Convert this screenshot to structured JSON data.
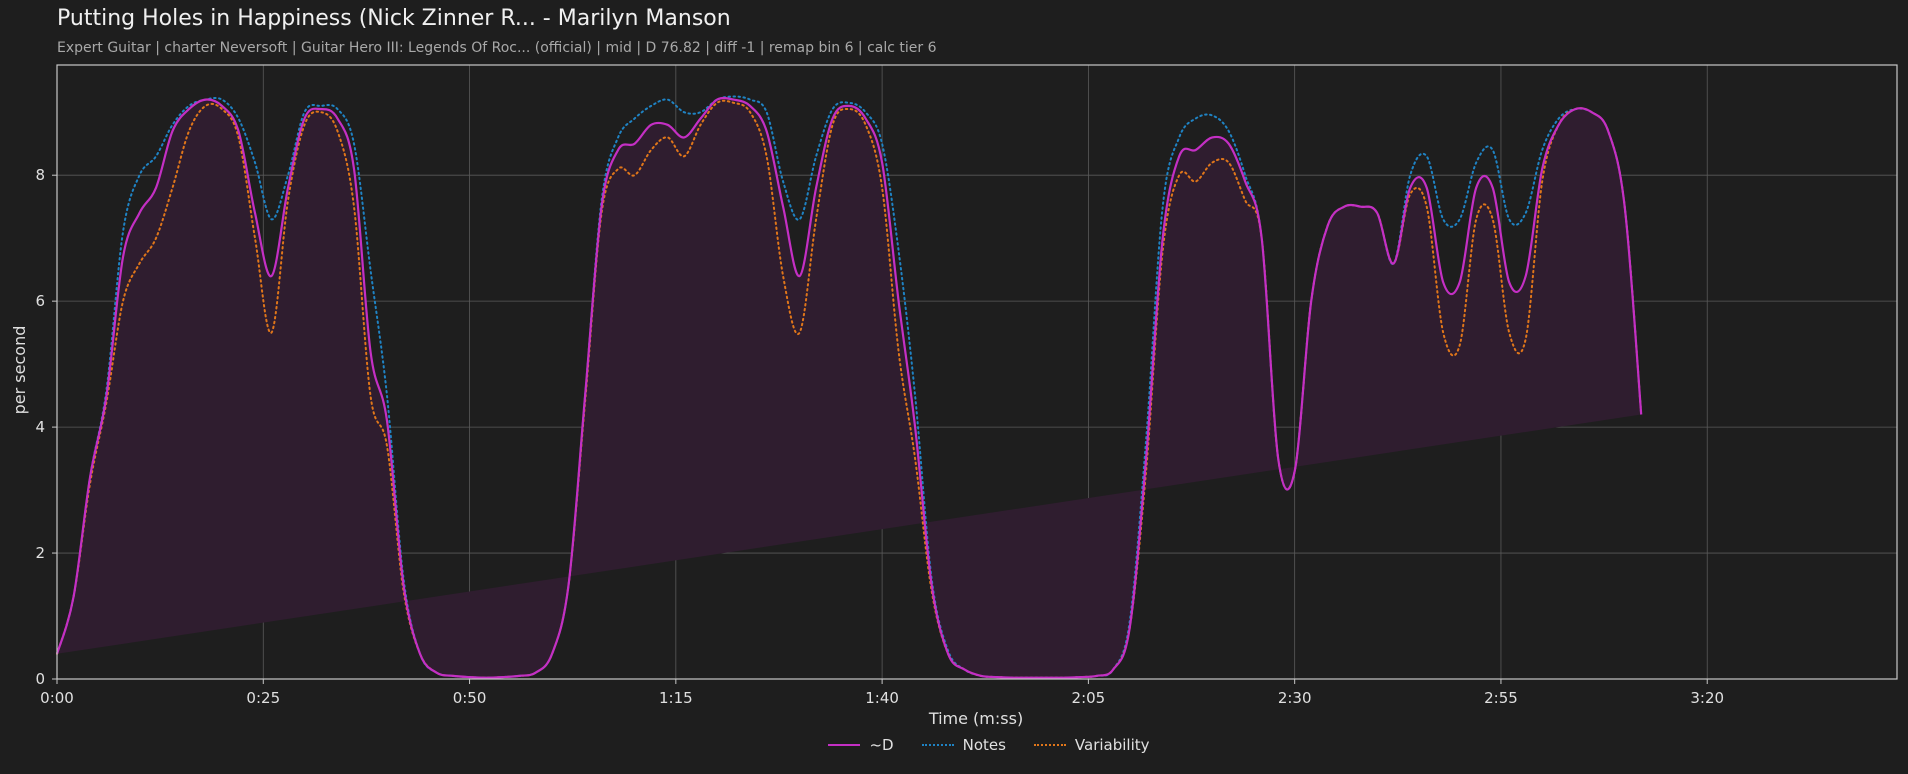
{
  "header": {
    "title": "Putting Holes in Happiness (Nick Zinner R... - Marilyn Manson",
    "subtitle": "Expert Guitar  |  charter Neversoft  |  Guitar Hero III: Legends Of Roc... (official)  |  mid  |  D 76.82  |  diff -1  |  remap bin 6  |  calc tier 6"
  },
  "colors": {
    "background": "#1e1e1e",
    "d_line": "#c42fc4",
    "d_fill": "#2f1d2f",
    "notes_line": "#1f83c4",
    "variability_line": "#e0761a",
    "grid": "#5a5a5a",
    "axis": "#c8c8c8"
  },
  "chart_data": {
    "type": "line",
    "title": "Putting Holes in Happiness (Nick Zinner R... - Marilyn Manson",
    "xlabel": "Time (m:ss)",
    "ylabel": "per second",
    "xlim": [
      0,
      223
    ],
    "ylim": [
      0,
      9.75
    ],
    "grid": true,
    "legend_position": "bottom-center",
    "x_ticks": [
      {
        "value": 0,
        "label": "0:00"
      },
      {
        "value": 25,
        "label": "0:25"
      },
      {
        "value": 50,
        "label": "0:50"
      },
      {
        "value": 75,
        "label": "1:15"
      },
      {
        "value": 100,
        "label": "1:40"
      },
      {
        "value": 125,
        "label": "2:05"
      },
      {
        "value": 150,
        "label": "2:30"
      },
      {
        "value": 175,
        "label": "2:55"
      },
      {
        "value": 200,
        "label": "3:20"
      }
    ],
    "y_ticks": [
      {
        "value": 0,
        "label": "0"
      },
      {
        "value": 2,
        "label": "2"
      },
      {
        "value": 4,
        "label": "4"
      },
      {
        "value": 6,
        "label": "6"
      },
      {
        "value": 8,
        "label": "8"
      }
    ],
    "x": [
      0,
      2,
      4,
      6,
      8,
      10,
      12,
      14,
      16,
      18,
      20,
      22,
      24,
      26,
      28,
      30,
      32,
      34,
      36,
      38,
      40,
      42,
      44,
      46,
      48,
      50,
      52,
      54,
      56,
      58,
      60,
      62,
      64,
      66,
      68,
      70,
      72,
      74,
      76,
      78,
      80,
      82,
      84,
      86,
      88,
      90,
      92,
      94,
      96,
      98,
      100,
      102,
      104,
      106,
      108,
      110,
      112,
      114,
      116,
      118,
      120,
      122,
      124,
      126,
      128,
      130,
      132,
      134,
      136,
      138,
      140,
      142,
      144,
      146,
      148,
      150,
      152,
      154,
      156,
      158,
      160,
      162,
      164,
      166,
      168,
      170,
      172,
      174,
      176,
      178,
      180,
      182,
      184,
      186,
      188,
      190,
      192,
      194,
      196,
      198,
      200,
      202,
      204,
      206,
      208,
      210,
      212,
      214,
      216,
      218,
      220,
      222,
      223
    ],
    "series": [
      {
        "name": "~D",
        "style": "solid",
        "values": [
          0.4,
          1.3,
          3.2,
          4.5,
          6.7,
          7.4,
          7.8,
          8.7,
          9.05,
          9.2,
          9.1,
          8.7,
          7.4,
          6.4,
          7.8,
          8.9,
          9.05,
          8.9,
          8.1,
          5.2,
          4.1,
          1.5,
          0.4,
          0.1,
          0.05,
          0.03,
          0.02,
          0.03,
          0.05,
          0.1,
          0.4,
          1.5,
          4.5,
          7.5,
          8.4,
          8.5,
          8.8,
          8.8,
          8.6,
          8.9,
          9.2,
          9.2,
          9.1,
          8.7,
          7.5,
          6.4,
          7.8,
          8.9,
          9.1,
          8.9,
          8.2,
          6.0,
          4.0,
          1.5,
          0.4,
          0.15,
          0.05,
          0.03,
          0.02,
          0.02,
          0.02,
          0.02,
          0.03,
          0.05,
          0.15,
          0.8,
          3.5,
          7.0,
          8.3,
          8.4,
          8.6,
          8.5,
          7.9,
          7.0,
          3.5,
          3.3,
          6.0,
          7.2,
          7.5,
          7.5,
          7.4,
          6.6,
          7.8,
          7.8,
          6.3,
          6.3,
          7.8,
          7.8,
          6.3,
          6.4,
          8.1,
          8.8,
          9.05,
          9.0,
          8.7,
          7.5,
          4.2,
          0.4
        ]
      },
      {
        "name": "Notes",
        "style": "dotted",
        "values": [
          0.4,
          1.3,
          3.2,
          4.6,
          7.1,
          8.0,
          8.3,
          8.8,
          9.1,
          9.2,
          9.2,
          8.9,
          8.2,
          7.3,
          8.0,
          9.0,
          9.1,
          9.05,
          8.5,
          6.5,
          4.5,
          1.6,
          0.4,
          0.1,
          0.05,
          0.03,
          0.02,
          0.03,
          0.05,
          0.1,
          0.4,
          1.5,
          4.5,
          7.6,
          8.6,
          8.9,
          9.1,
          9.2,
          9.0,
          9.0,
          9.2,
          9.25,
          9.2,
          9.0,
          7.9,
          7.3,
          8.3,
          9.05,
          9.15,
          9.0,
          8.5,
          6.8,
          4.5,
          1.6,
          0.45,
          0.15,
          0.05,
          0.03,
          0.02,
          0.02,
          0.02,
          0.02,
          0.03,
          0.05,
          0.15,
          0.9,
          3.8,
          7.5,
          8.6,
          8.9,
          8.95,
          8.7,
          8.0,
          7.0,
          3.5,
          3.3,
          6.0,
          7.2,
          7.5,
          7.5,
          7.4,
          6.6,
          8.0,
          8.3,
          7.3,
          7.3,
          8.2,
          8.4,
          7.3,
          7.4,
          8.4,
          8.9,
          9.05,
          9.0,
          8.7,
          7.5,
          4.2,
          0.4
        ]
      },
      {
        "name": "Variability",
        "style": "dotted",
        "values": [
          0.4,
          1.3,
          3.1,
          4.4,
          6.0,
          6.6,
          7.0,
          7.8,
          8.7,
          9.1,
          9.05,
          8.6,
          7.0,
          5.5,
          7.6,
          8.8,
          9.0,
          8.7,
          7.5,
          4.5,
          3.7,
          1.4,
          0.4,
          0.1,
          0.05,
          0.03,
          0.02,
          0.03,
          0.05,
          0.1,
          0.4,
          1.5,
          4.4,
          7.4,
          8.1,
          8.0,
          8.4,
          8.6,
          8.3,
          8.8,
          9.15,
          9.15,
          9.0,
          8.3,
          6.4,
          5.5,
          7.3,
          8.8,
          9.05,
          8.8,
          7.8,
          5.2,
          3.5,
          1.4,
          0.4,
          0.15,
          0.05,
          0.03,
          0.02,
          0.02,
          0.02,
          0.02,
          0.03,
          0.05,
          0.15,
          0.8,
          3.3,
          6.8,
          8.0,
          7.9,
          8.2,
          8.2,
          7.6,
          7.0,
          3.5,
          3.3,
          6.0,
          7.2,
          7.5,
          7.5,
          7.4,
          6.6,
          7.7,
          7.5,
          5.5,
          5.3,
          7.3,
          7.3,
          5.5,
          5.4,
          7.9,
          8.8,
          9.05,
          9.0,
          8.7,
          7.5,
          4.2,
          0.4
        ]
      }
    ]
  }
}
